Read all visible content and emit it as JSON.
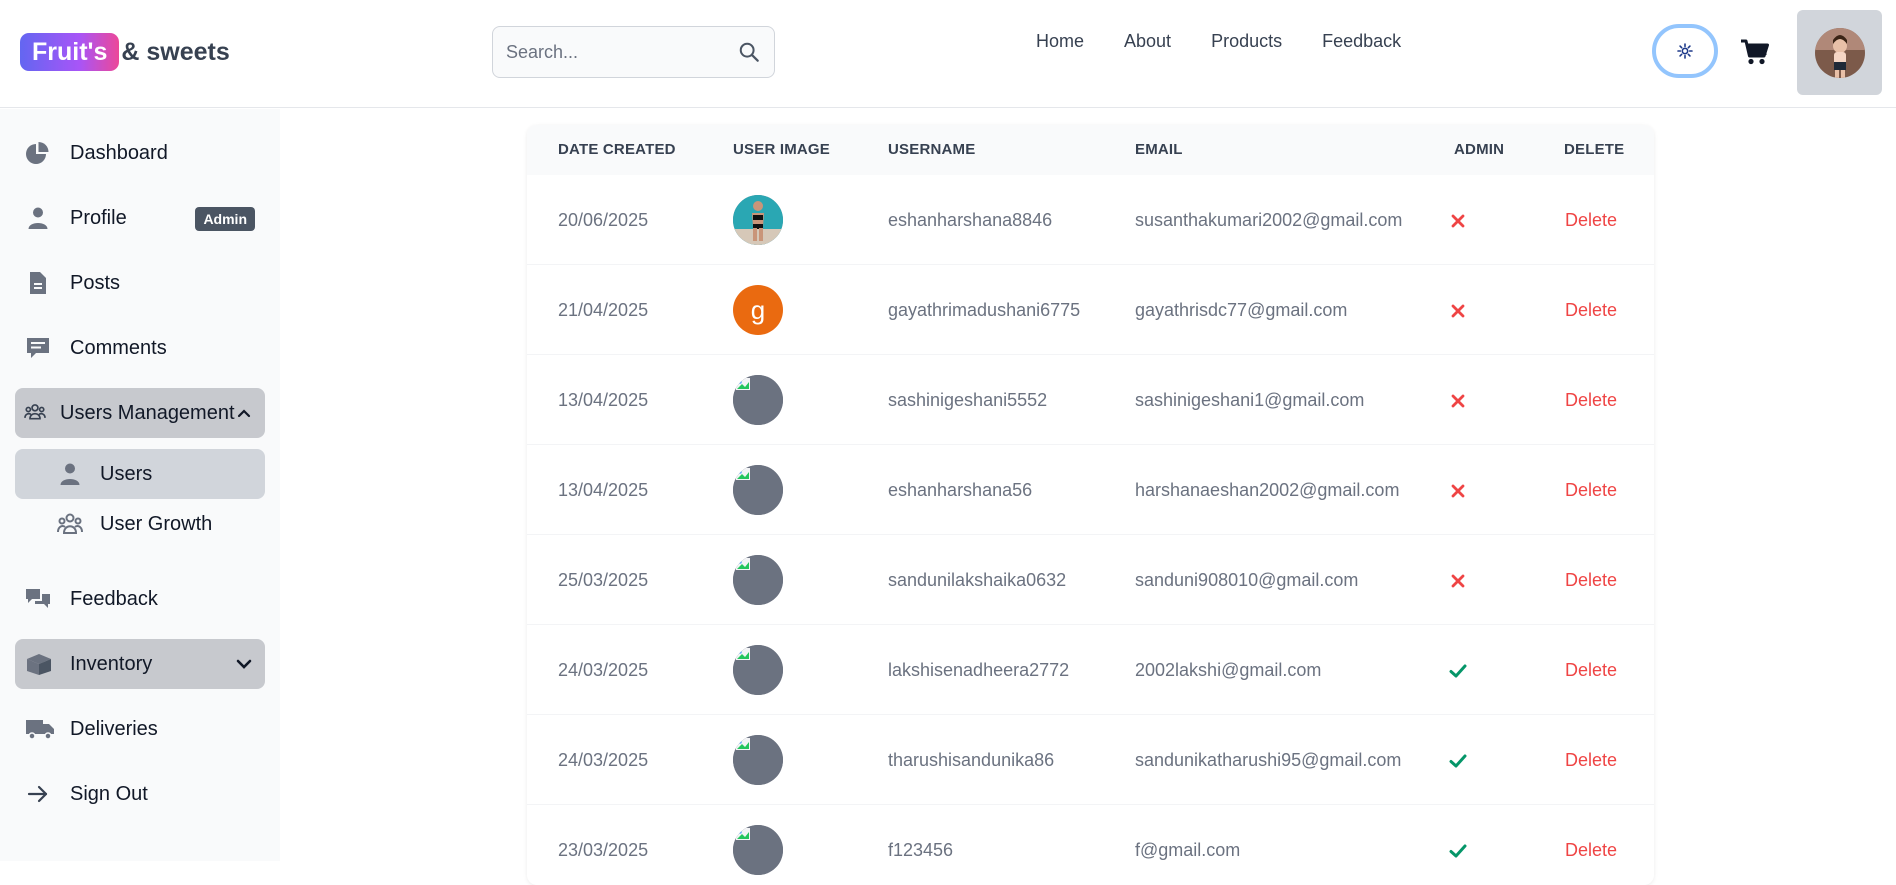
{
  "header": {
    "brand_pill": "Fruit's",
    "brand_rest": "& sweets",
    "search_placeholder": "Search...",
    "nav": [
      "Home",
      "About",
      "Products",
      "Feedback"
    ],
    "theme_icon": "sun-icon",
    "cart_icon": "cart-icon"
  },
  "sidebar": {
    "dashboard": "Dashboard",
    "profile": "Profile",
    "profile_badge": "Admin",
    "posts": "Posts",
    "comments": "Comments",
    "users_management": "Users Management",
    "users": "Users",
    "user_growth": "User Growth",
    "feedback": "Feedback",
    "inventory": "Inventory",
    "deliveries": "Deliveries",
    "sign_out": "Sign Out"
  },
  "table": {
    "headers": [
      "DATE CREATED",
      "USER IMAGE",
      "USERNAME",
      "EMAIL",
      "ADMIN",
      "DELETE"
    ],
    "delete_label": "Delete",
    "rows": [
      {
        "date": "20/06/2025",
        "image": "photo",
        "username": "eshanharshana8846",
        "email": "susanthakumari2002@gmail.com",
        "admin": false
      },
      {
        "date": "21/04/2025",
        "image": "g",
        "username": "gayathrimadushani6775",
        "email": "gayathrisdc77@gmail.com",
        "admin": false
      },
      {
        "date": "13/04/2025",
        "image": "broken",
        "username": "sashinigeshani5552",
        "email": "sashinigeshani1@gmail.com",
        "admin": false
      },
      {
        "date": "13/04/2025",
        "image": "broken",
        "username": "eshanharshana56",
        "email": "harshanaeshan2002@gmail.com",
        "admin": false
      },
      {
        "date": "25/03/2025",
        "image": "broken",
        "username": "sandunilakshaika0632",
        "email": "sanduni908010@gmail.com",
        "admin": false
      },
      {
        "date": "24/03/2025",
        "image": "broken",
        "username": "lakshisenadheera2772",
        "email": "2002lakshi@gmail.com",
        "admin": true
      },
      {
        "date": "24/03/2025",
        "image": "broken",
        "username": "tharushisandunika86",
        "email": "sandunikatharushi95@gmail.com",
        "admin": true
      },
      {
        "date": "23/03/2025",
        "image": "broken",
        "username": "f123456",
        "email": "f@gmail.com",
        "admin": true
      }
    ]
  },
  "colors": {
    "brand_gradient_start": "#6366f1",
    "brand_gradient_end": "#ec4899",
    "delete": "#ef4444",
    "admin_no": "#ef4444",
    "admin_yes": "#059669",
    "active_bg": "#c7c9ce"
  }
}
